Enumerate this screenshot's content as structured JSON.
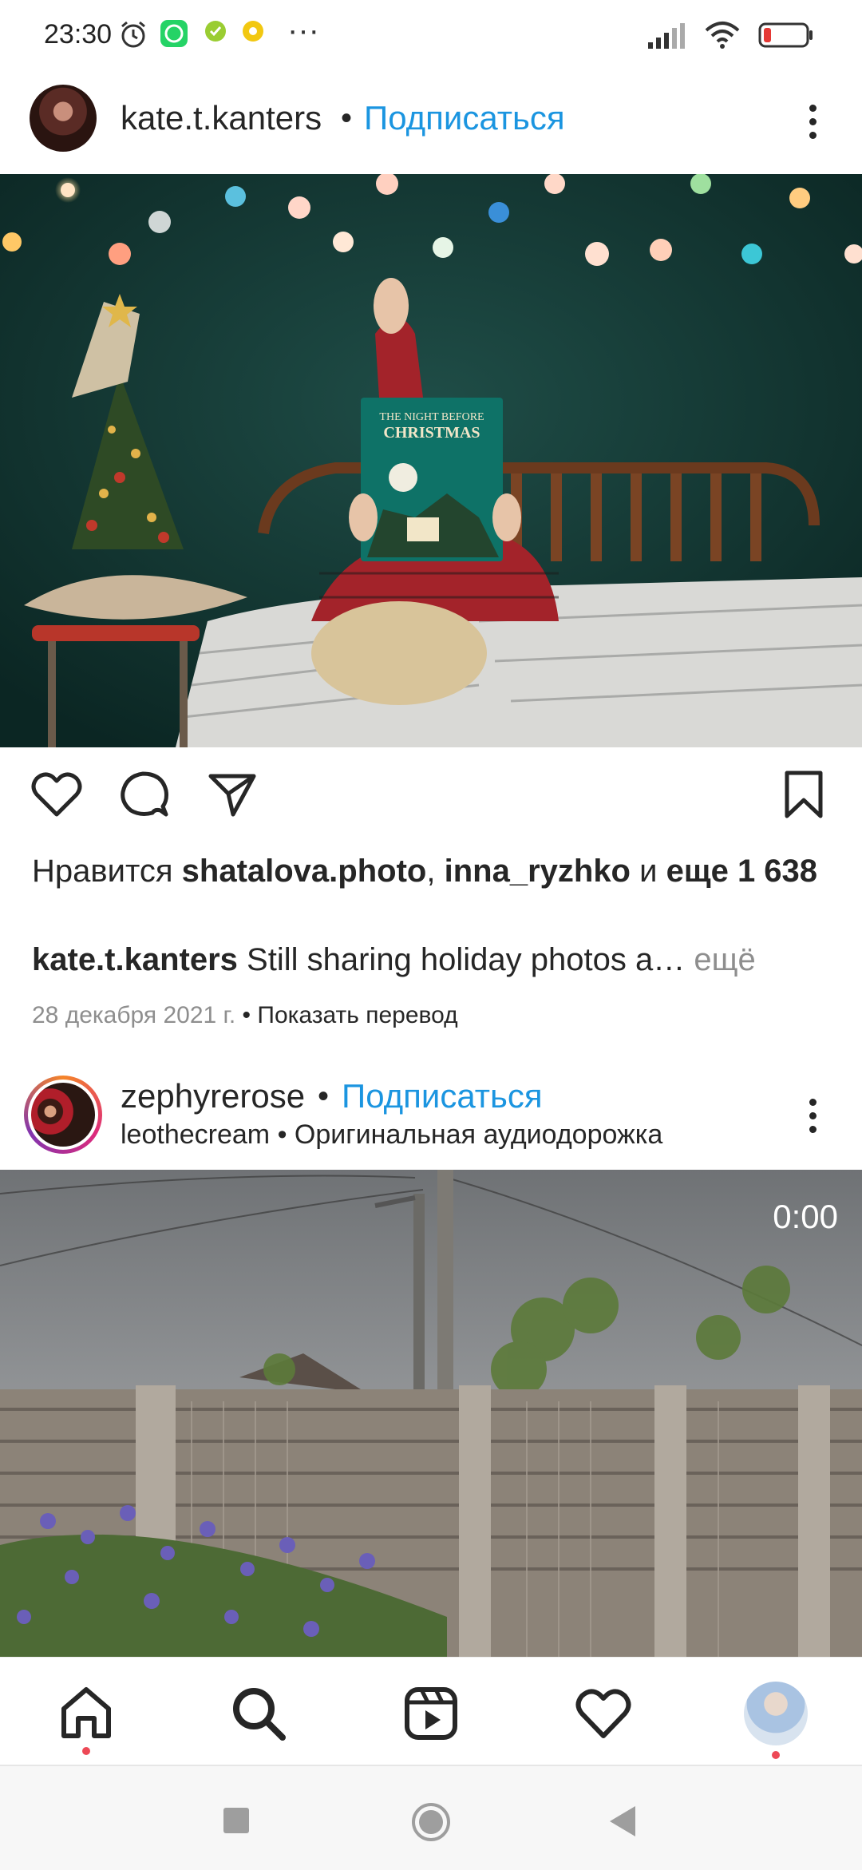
{
  "status_bar": {
    "time": "23:30",
    "icons_left": [
      "alarm-icon",
      "whatsapp-icon",
      "app-icon",
      "app-icon",
      "more-icon"
    ],
    "overflow": "···",
    "icons_right": [
      "signal-icon",
      "wifi-icon",
      "battery-icon"
    ]
  },
  "post1": {
    "username": "kate.t.kanters",
    "separator": "•",
    "follow_label": "Подписаться",
    "likes": {
      "prefix": "Нравится",
      "user1": "shatalova.photo",
      "comma": ",",
      "user2": "inna_ryzhko",
      "and": "и",
      "more_label": "еще 1 638"
    },
    "caption": {
      "username": "kate.t.kanters",
      "text": "Still sharing holiday photos a…",
      "more_label": "ещё"
    },
    "date": "28 декабря 2021 г.",
    "date_sep": "•",
    "translate_label": "Показать перевод",
    "book_title": "THE NIGHT BEFORE CHRISTMAS"
  },
  "post2": {
    "username": "zephyrerose",
    "separator": "•",
    "follow_label": "Подписаться",
    "audio_user": "leothecream",
    "audio_sep": "•",
    "audio_label": "Оригинальная аудиодорожка",
    "video_time": "0:00"
  },
  "colors": {
    "accent": "#1b95e0",
    "notification_dot": "#ed4956",
    "muted_text": "#8e8e8e"
  }
}
